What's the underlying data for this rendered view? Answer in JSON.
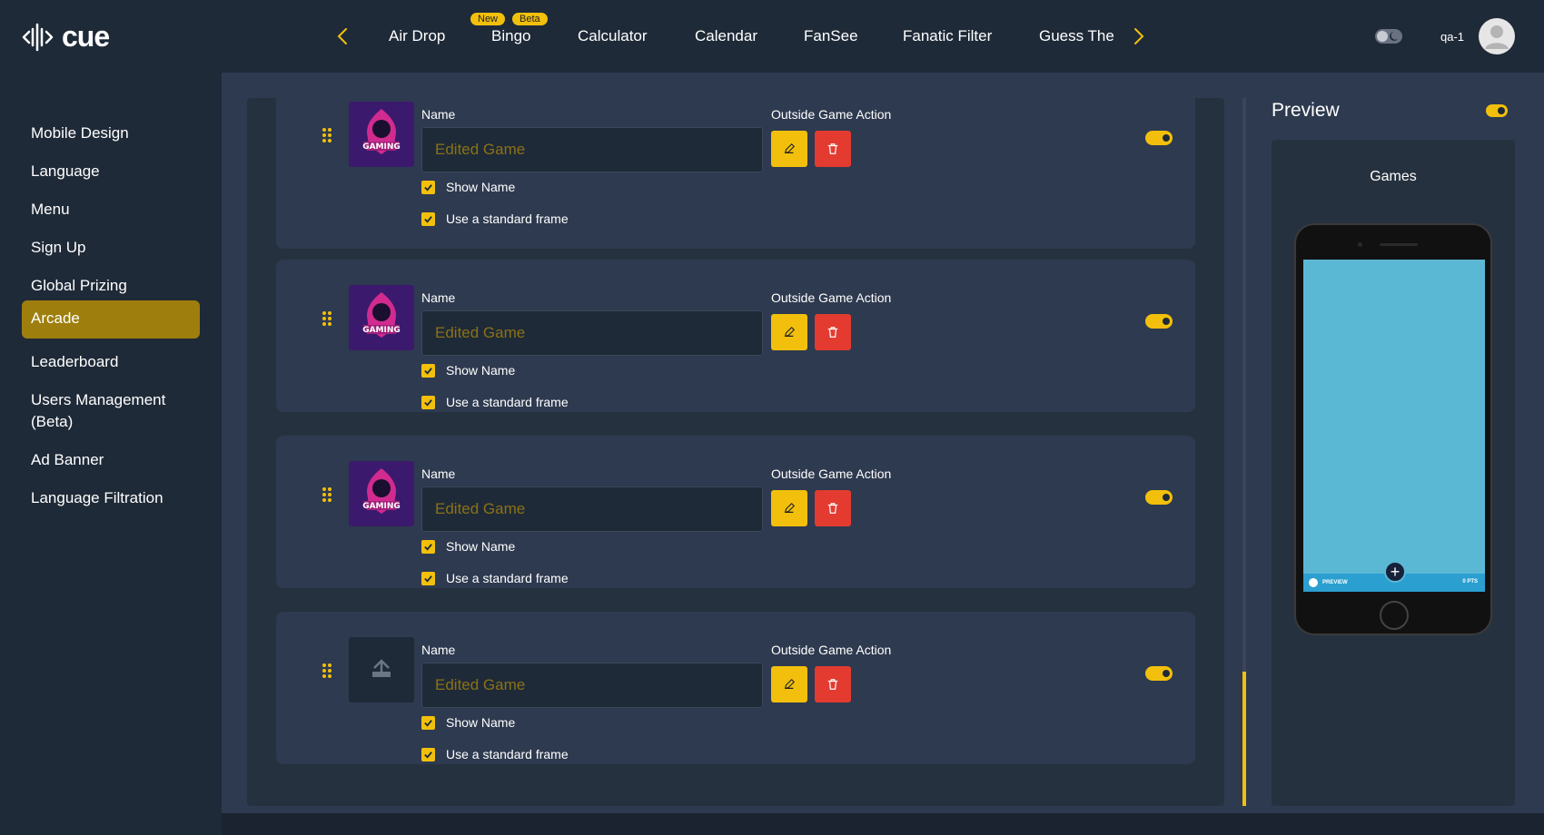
{
  "app": {
    "logo_text": "cue",
    "user_name": "qa-1"
  },
  "colors": {
    "accent": "#f2c00c",
    "danger": "#e43b30",
    "active_nav": "#9e7e0d",
    "background": "#2e3a4f",
    "panel": "#1f2a38"
  },
  "topnav": {
    "items": [
      {
        "label": "Air Drop"
      },
      {
        "label": "Bingo",
        "badges": [
          "New",
          "Beta"
        ]
      },
      {
        "label": "Calculator"
      },
      {
        "label": "Calendar"
      },
      {
        "label": "FanSee"
      },
      {
        "label": "Fanatic Filter"
      },
      {
        "label": "Guess The"
      }
    ],
    "prev_icon": "chevron-left-icon",
    "next_icon": "chevron-right-icon"
  },
  "sidebar": {
    "items": [
      {
        "label": "Mobile Design"
      },
      {
        "label": "Language"
      },
      {
        "label": "Menu"
      },
      {
        "label": "Sign Up"
      },
      {
        "label": "Global Prizing"
      },
      {
        "label": "Arcade",
        "active": true
      },
      {
        "label": "Leaderboard"
      },
      {
        "label": "Users Management (Beta)"
      },
      {
        "label": "Ad Banner"
      },
      {
        "label": "Language Filtration"
      }
    ]
  },
  "games": {
    "name_label": "Name",
    "action_label": "Outside Game Action",
    "show_name_label": "Show Name",
    "standard_frame_label": "Use a standard frame",
    "thumb_text": "GAMING",
    "items": [
      {
        "placeholder": "Edited Game",
        "thumbnail": "gaming-logo",
        "show_name": true,
        "standard_frame": true,
        "enabled": true
      },
      {
        "placeholder": "Edited Game",
        "thumbnail": "gaming-logo",
        "show_name": true,
        "standard_frame": true,
        "enabled": true
      },
      {
        "placeholder": "Edited Game",
        "thumbnail": "gaming-logo",
        "show_name": true,
        "standard_frame": true,
        "enabled": true
      },
      {
        "placeholder": "Edited Game",
        "thumbnail": "upload-icon",
        "show_name": true,
        "standard_frame": true,
        "enabled": true
      }
    ]
  },
  "preview": {
    "title": "Preview",
    "heading": "Games",
    "bar_left": "PREVIEW",
    "bar_right": "0 PTS",
    "enabled": true
  }
}
